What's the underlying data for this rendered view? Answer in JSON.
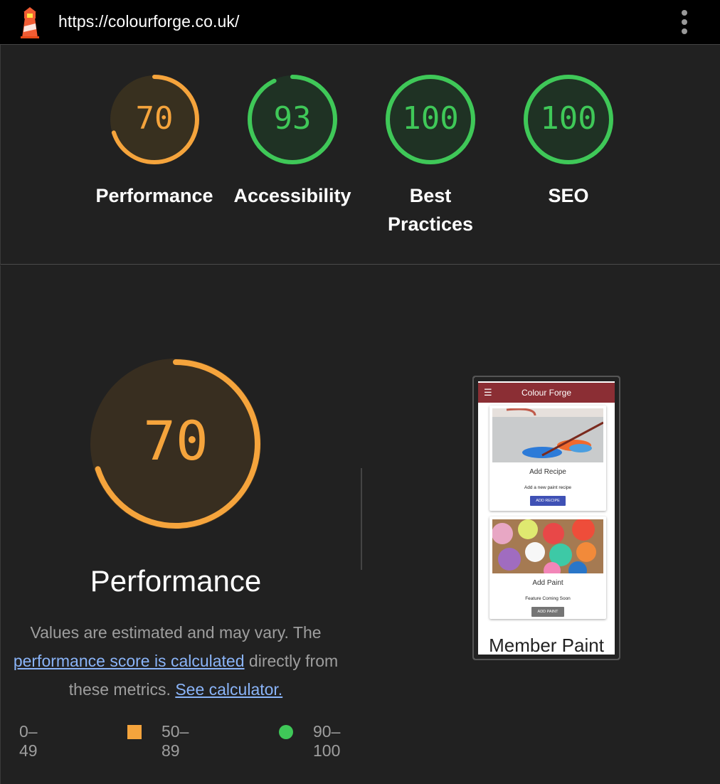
{
  "topbar": {
    "url": "https://colourforge.co.uk/",
    "logo_icon": "lighthouse-icon",
    "menu_icon": "more-vertical-icon"
  },
  "gauges": [
    {
      "label": "Performance",
      "score": "70",
      "value": 70,
      "status": "average",
      "color": "#f5a43c"
    },
    {
      "label": "Accessibility",
      "score": "93",
      "value": 93,
      "status": "pass",
      "color": "#3fc858"
    },
    {
      "label": "Best Practices",
      "score": "100",
      "value": 100,
      "status": "pass",
      "color": "#3fc858"
    },
    {
      "label": "SEO",
      "score": "100",
      "value": 100,
      "status": "pass",
      "color": "#3fc858"
    }
  ],
  "performance": {
    "score": "70",
    "value": 70,
    "title": "Performance",
    "desc_prefix": "Values are estimated and may vary. The",
    "desc_link1": "performance score is calculated",
    "desc_mid": " directly from these metrics.",
    "desc_link2": "See calculator."
  },
  "legend": [
    {
      "range": "0–49",
      "shape": "triangle",
      "color": "#ff4e42"
    },
    {
      "range": "50–89",
      "shape": "square",
      "color": "#f5a43c"
    },
    {
      "range": "90–100",
      "shape": "circle",
      "color": "#3fc858"
    }
  ],
  "screenshot": {
    "app_title": "Colour Forge",
    "menu_icon": "hamburger-icon",
    "cards": [
      {
        "title": "Add Recipe",
        "subtitle": "Add a new paint recipe",
        "button": "ADD RECIPE",
        "button_color": "#3f51b5"
      },
      {
        "title": "Add Paint",
        "subtitle": "Feature Coming Soon",
        "button": "ADD PAINT",
        "button_color": "#757575"
      }
    ],
    "footer_text": "Member Paint"
  },
  "colors": {
    "background": "#212121",
    "average": "#f5a43c",
    "pass": "#3fc858",
    "link": "#8ab4f8"
  }
}
